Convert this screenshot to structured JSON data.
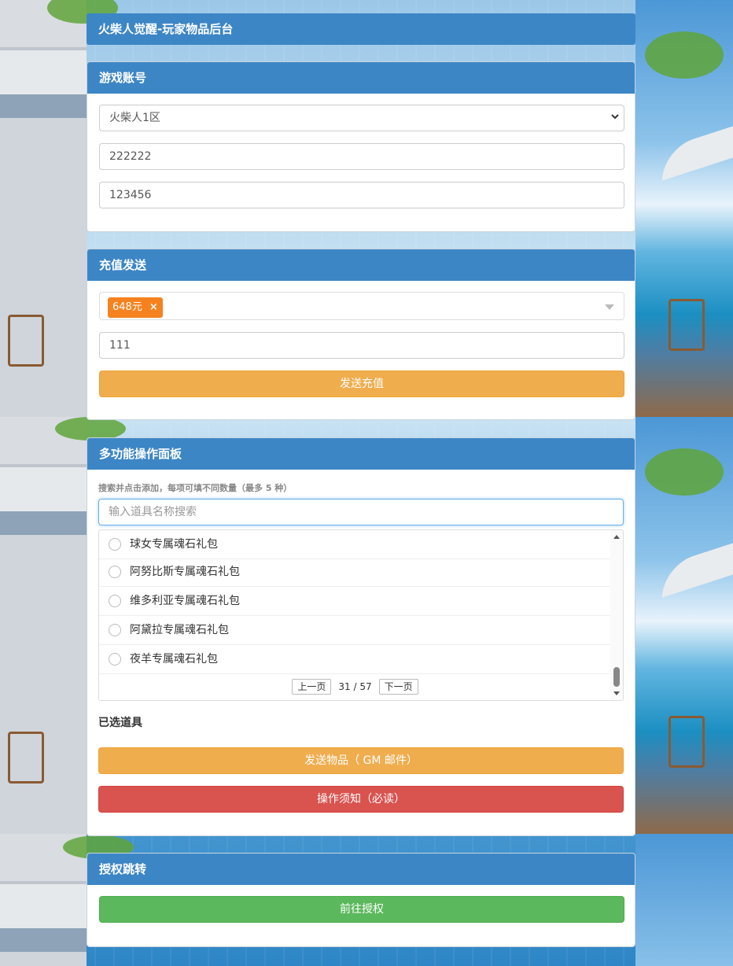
{
  "header": {
    "title": "火柴人觉醒-玩家物品后台"
  },
  "account": {
    "title": "游戏账号",
    "server": "火柴人1区",
    "username": "222222",
    "password": "123456"
  },
  "recharge": {
    "title": "充值发送",
    "selected_tag": "648元",
    "tag_remove": "×",
    "amount": "111",
    "send_label": "发送充值"
  },
  "multi": {
    "title": "多功能操作面板",
    "hint": "搜索并点击添加，每项可填不同数量（最多 5 种）",
    "search_placeholder": "输入道具名称搜索",
    "items": [
      {
        "label": "球女专属魂石礼包"
      },
      {
        "label": "阿努比斯专属魂石礼包"
      },
      {
        "label": "维多利亚专属魂石礼包"
      },
      {
        "label": "阿黛拉专属魂石礼包"
      },
      {
        "label": "夜羊专属魂石礼包"
      }
    ],
    "pager": {
      "prev": "上一页",
      "info": "31 / 57",
      "next": "下一页"
    },
    "selected_label": "已选道具",
    "send_label": "发送物品（ GM 邮件）",
    "notice_label": "操作须知（必读）"
  },
  "auth": {
    "title": "授权跳转",
    "go_label": "前往授权"
  },
  "colors": {
    "header_blue": "#3d86c6",
    "orange": "#f0ad4e",
    "red": "#d9534f",
    "green": "#5cb85c",
    "tag_orange": "#f5821f"
  }
}
